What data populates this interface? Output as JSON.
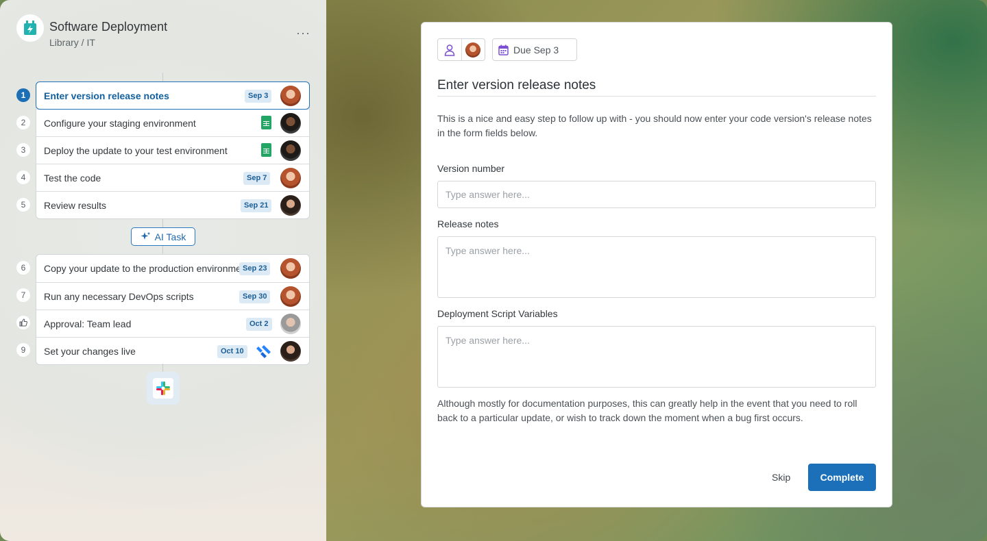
{
  "workflow": {
    "title": "Software Deployment",
    "breadcrumb": "Library / IT",
    "more_label": "···"
  },
  "tasks_group1": [
    {
      "num": "1",
      "label": "Enter version release notes",
      "due": "Sep 3",
      "avatar": "avatar-red-hair",
      "active": true
    },
    {
      "num": "2",
      "label": "Configure your staging environment",
      "due": "",
      "integration": "google-sheets-icon",
      "avatar": "avatar-dark-hair"
    },
    {
      "num": "3",
      "label": "Deploy the update to your test environment",
      "due": "",
      "integration": "google-sheets-icon",
      "avatar": "avatar-dark-hair"
    },
    {
      "num": "4",
      "label": "Test the code",
      "due": "Sep 7",
      "avatar": "avatar-red-hair"
    },
    {
      "num": "5",
      "label": "Review results",
      "due": "Sep 21",
      "avatar": "avatar-woman"
    }
  ],
  "ai_task_label": "AI Task",
  "tasks_group2": [
    {
      "num": "6",
      "label": "Copy your update to the production environment",
      "due": "Sep 23",
      "avatar": "avatar-red-hair"
    },
    {
      "num": "7",
      "label": "Run any necessary DevOps scripts",
      "due": "Sep 30",
      "avatar": "avatar-red-hair"
    },
    {
      "num": "thumbs-up-icon",
      "label": "Approval: Team lead",
      "due": "Oct 2",
      "avatar": "avatar-grey-hair"
    },
    {
      "num": "9",
      "label": "Set your changes live",
      "due": "Oct 10",
      "integration": "jira-icon",
      "avatar": "avatar-woman"
    }
  ],
  "task_detail": {
    "due_label": "Due Sep 3",
    "title": "Enter version release notes",
    "description": "This is a nice and easy step to follow up with - you should now enter your code version's release notes in the form fields below.",
    "fields": [
      {
        "label": "Version number",
        "placeholder": "Type answer here...",
        "value": ""
      },
      {
        "label": "Release notes",
        "placeholder": "Type answer here...",
        "value": ""
      },
      {
        "label": "Deployment Script Variables",
        "placeholder": "Type answer here...",
        "value": ""
      }
    ],
    "footnote": "Although mostly for documentation purposes, this can greatly help in the event that you need to roll back to a particular update, or wish to track down the moment when a bug first occurs.",
    "skip_label": "Skip",
    "complete_label": "Complete"
  },
  "colors": {
    "accent": "#1c70b9",
    "badge_bg": "#dceaf6",
    "sheets_green": "#23a566"
  }
}
